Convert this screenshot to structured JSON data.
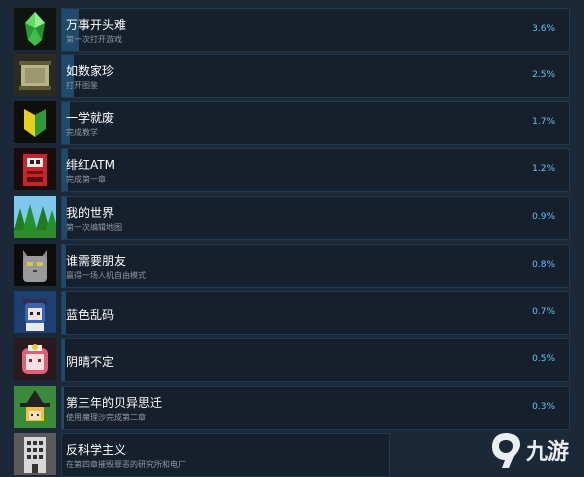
{
  "achievements": [
    {
      "name": "万事开头难",
      "desc": "第一次打开游戏",
      "pct": "3.6%",
      "pct_value": 0.036,
      "icon": "green-gem-icon"
    },
    {
      "name": "如数家珍",
      "desc": "打开图鉴",
      "pct": "2.5%",
      "pct_value": 0.025,
      "icon": "scroll-icon"
    },
    {
      "name": "一学就废",
      "desc": "完成教学",
      "pct": "1.7%",
      "pct_value": 0.017,
      "icon": "beginner-badge-icon"
    },
    {
      "name": "绯红ATM",
      "desc": "完成第一章",
      "pct": "1.2%",
      "pct_value": 0.012,
      "icon": "red-atm-icon"
    },
    {
      "name": "我的世界",
      "desc": "第一次编辑地图",
      "pct": "0.9%",
      "pct_value": 0.009,
      "icon": "forest-icon"
    },
    {
      "name": "谁需要朋友",
      "desc": "赢得一场人机自由模式",
      "pct": "0.8%",
      "pct_value": 0.008,
      "icon": "gray-cat-icon"
    },
    {
      "name": "蓝色乱码",
      "desc": "",
      "pct": "0.7%",
      "pct_value": 0.007,
      "icon": "blue-maid-icon"
    },
    {
      "name": "阴晴不定",
      "desc": "",
      "pct": "0.5%",
      "pct_value": 0.005,
      "icon": "pink-girl-icon"
    },
    {
      "name": "第三年的贝异思迁",
      "desc": "使用魔理沙完成第二章",
      "pct": "0.3%",
      "pct_value": 0.003,
      "icon": "witch-hat-icon"
    },
    {
      "name": "反科学主义",
      "desc": "在第四章摧毁罪恶的研究所和电厂",
      "pct": "",
      "pct_value": null,
      "icon": "building-icon"
    }
  ],
  "watermark": {
    "text": "九游",
    "icon": "jiuyou-logo-icon"
  },
  "colors": {
    "background": "#1b2838",
    "bar": "#16202d",
    "fill": "#1f4a6b",
    "percent": "#66c0f4"
  }
}
